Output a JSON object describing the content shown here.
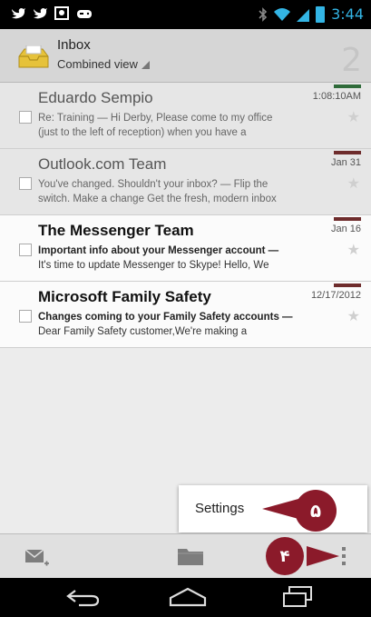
{
  "status_bar": {
    "time": "3:44",
    "icons": [
      "twitter-icon",
      "twitter-icon",
      "photo-icon",
      "gamepad-icon",
      "bluetooth-icon",
      "wifi-icon",
      "signal-icon",
      "battery-icon"
    ]
  },
  "action_bar": {
    "title": "Inbox",
    "subtitle": "Combined view",
    "unread_count": "2"
  },
  "messages": [
    {
      "sender": "Eduardo Sempio",
      "date": "1:08:10AM",
      "line1": "Re: Training — Hi Derby, Please come to my office",
      "line2": "(just to the left of reception) when you have a",
      "read": true,
      "tag_color": "#2f6b3a"
    },
    {
      "sender": "Outlook.com Team",
      "date": "Jan 31",
      "line1": "You've changed. Shouldn't your inbox? — Flip the",
      "line2": "switch. Make a change Get the fresh, modern inbox",
      "read": true,
      "tag_color": "#6e2c2c"
    },
    {
      "sender": "The Messenger Team",
      "date": "Jan 16",
      "line1": "Important info about your Messenger account —",
      "line2": "It's time to update Messenger to Skype! Hello, We",
      "read": false,
      "tag_color": "#6e2c2c"
    },
    {
      "sender": "Microsoft Family Safety",
      "date": "12/17/2012",
      "line1": "Changes coming to your Family Safety accounts —",
      "line2": "Dear Family Safety customer,We're making a",
      "read": false,
      "tag_color": "#6e2c2c"
    }
  ],
  "overflow_menu": {
    "items": [
      "Settings"
    ]
  },
  "annotations": {
    "step_settings": "۵",
    "step_menu": "۴",
    "color": "#8b1a2a"
  },
  "bottom_bar": {
    "icons": [
      "compose-icon",
      "folder-icon",
      "overflow-menu-icon"
    ]
  },
  "nav_bar": {
    "icons": [
      "back-icon",
      "home-icon",
      "recents-icon"
    ]
  }
}
